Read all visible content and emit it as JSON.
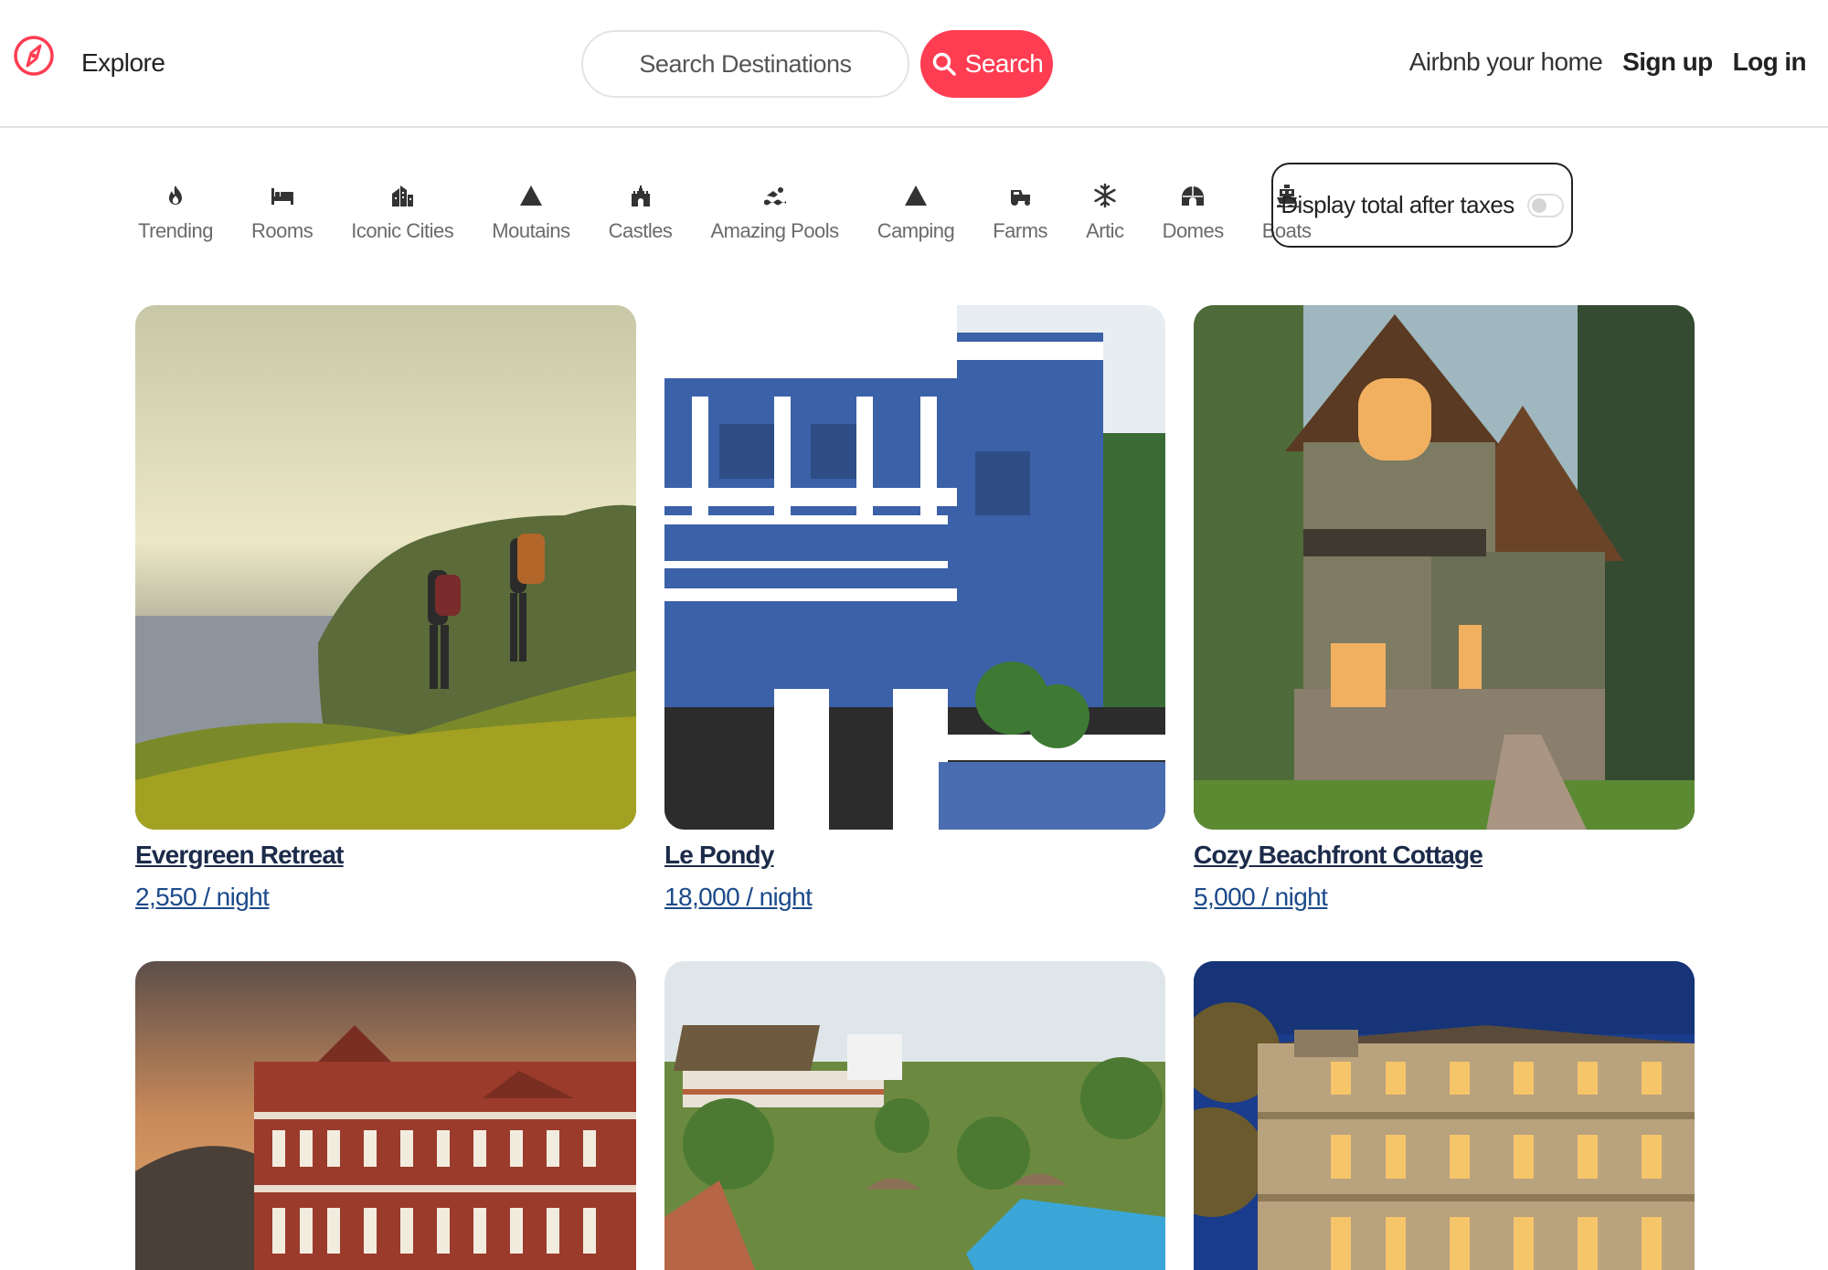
{
  "header": {
    "explore_label": "Explore",
    "search_placeholder": "Search Destinations",
    "search_button": "Search",
    "host_link": "Airbnb your home",
    "signup_link": "Sign up",
    "login_link": "Log in",
    "brand_color": "#ff3d52"
  },
  "categories": [
    {
      "label": "Trending",
      "icon": "fire-icon"
    },
    {
      "label": "Rooms",
      "icon": "bed-icon"
    },
    {
      "label": "Iconic Cities",
      "icon": "city-icon"
    },
    {
      "label": "Moutains",
      "icon": "mountain-icon"
    },
    {
      "label": "Castles",
      "icon": "castle-icon"
    },
    {
      "label": "Amazing Pools",
      "icon": "swimmer-icon"
    },
    {
      "label": "Camping",
      "icon": "tent-icon"
    },
    {
      "label": "Farms",
      "icon": "tractor-icon"
    },
    {
      "label": "Artic",
      "icon": "snowflake-icon"
    },
    {
      "label": "Domes",
      "icon": "dome-icon"
    },
    {
      "label": "Boats",
      "icon": "ship-icon"
    }
  ],
  "taxes_toggle": {
    "label": "Display total after taxes",
    "on": false
  },
  "listings": [
    {
      "title": "Evergreen Retreat",
      "price": "2,550 / night"
    },
    {
      "title": "Le Pondy",
      "price": "18,000 / night"
    },
    {
      "title": "Cozy Beachfront Cottage",
      "price": "5,000 / night"
    },
    {
      "title": "",
      "price": ""
    },
    {
      "title": "",
      "price": ""
    },
    {
      "title": "",
      "price": ""
    }
  ]
}
